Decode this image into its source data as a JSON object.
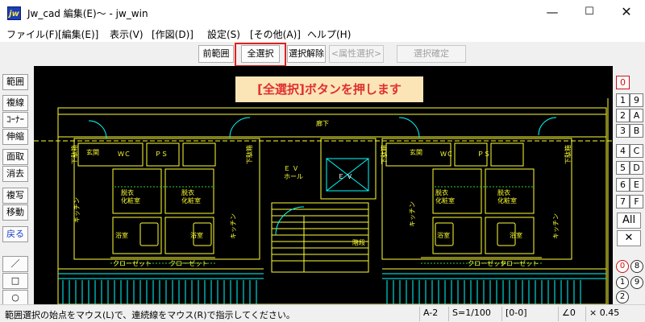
{
  "window": {
    "title": "Jw_cad 編集(E)〜 - jw_win",
    "app_icon_text": "jw",
    "controls": {
      "minimize": "—",
      "maximize": "☐",
      "close": "✕"
    }
  },
  "menu": [
    "ファイル(F)",
    "[編集(E)]",
    "表示(V)",
    "[作図(D)]",
    "設定(S)",
    "[その他(A)]",
    "ヘルプ(H)"
  ],
  "toolbar": {
    "prev_range": "前範囲",
    "select_all": "全選択",
    "deselect": "選択解除",
    "attr_select": "<属性選択>",
    "confirm_select": "選択確定"
  },
  "left_tools": [
    "範囲",
    "複線",
    "ｺｰﾅｰ",
    "伸縮",
    "面取",
    "消去",
    "複写",
    "移動",
    "戻る",
    "／",
    "□",
    "○"
  ],
  "canvas": {
    "callout": "[全選択]ボタンを押します",
    "colors": {
      "background": "#000000",
      "line": "#ffff33",
      "accent": "#00ffff",
      "green": "#33cc33"
    },
    "labels": {
      "corridor": "廊下",
      "ev_hall": "Ｅ Ｖ\nホール",
      "ev": "Ｅ Ｖ",
      "stairs": "階段",
      "genkan": "玄関",
      "kitchen": "キッチン",
      "bath": "浴室",
      "washroom": "脱衣\n化粧室",
      "closet": "クローゼット",
      "toilet": "ＷＣ",
      "ps": "ＰＳ",
      "shoebox": "下駄箱"
    }
  },
  "layers": {
    "top": "0",
    "grid": [
      "1",
      "9",
      "2",
      "A",
      "3",
      "B",
      "4",
      "C",
      "5",
      "D",
      "6",
      "E",
      "7",
      "F"
    ],
    "all": "All",
    "cross": "✕",
    "groups": [
      "0",
      "8",
      "1",
      "9",
      "2"
    ]
  },
  "status": {
    "message": "範囲選択の始点をマウス(L)で、連続線をマウス(R)で指示してください。",
    "paper": "A-2",
    "scale": "S=1/100",
    "layer": "[0-0]",
    "angle": "∠0",
    "factor": "× 0.45"
  }
}
